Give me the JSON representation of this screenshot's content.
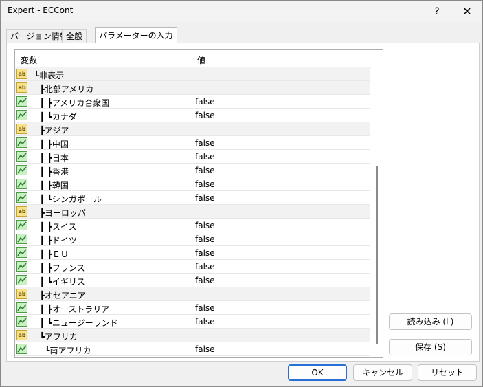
{
  "window": {
    "title": "Expert - ECCont",
    "help": "?",
    "close": "✕"
  },
  "tabs": [
    "バージョン情報",
    "全般",
    "パラメーターの入力"
  ],
  "grid": {
    "col_variable": "変数",
    "col_value": "値",
    "rows": [
      {
        "type": "ab",
        "name": "└非表示",
        "value": ""
      },
      {
        "type": "ab",
        "name": "  ┣北部アメリカ",
        "value": ""
      },
      {
        "type": "bool",
        "name": "  ┃ ┣アメリカ合衆国",
        "value": "false"
      },
      {
        "type": "bool",
        "name": "  ┃ ┗カナダ",
        "value": "false"
      },
      {
        "type": "ab",
        "name": "  ┣アジア",
        "value": ""
      },
      {
        "type": "bool",
        "name": "  ┃ ┣中国",
        "value": "false"
      },
      {
        "type": "bool",
        "name": "  ┃ ┣日本",
        "value": "false"
      },
      {
        "type": "bool",
        "name": "  ┃ ┣香港",
        "value": "false"
      },
      {
        "type": "bool",
        "name": "  ┃ ┣韓国",
        "value": "false"
      },
      {
        "type": "bool",
        "name": "  ┃ ┗シンガポール",
        "value": "false"
      },
      {
        "type": "ab",
        "name": "  ┣ヨーロッパ",
        "value": ""
      },
      {
        "type": "bool",
        "name": "  ┃ ┣スイス",
        "value": "false"
      },
      {
        "type": "bool",
        "name": "  ┃ ┣ドイツ",
        "value": "false"
      },
      {
        "type": "bool",
        "name": "  ┃ ┣ＥＵ",
        "value": "false"
      },
      {
        "type": "bool",
        "name": "  ┃ ┣フランス",
        "value": "false"
      },
      {
        "type": "bool",
        "name": "  ┃ ┗イギリス",
        "value": "false"
      },
      {
        "type": "ab",
        "name": "  ┣オセアニア",
        "value": ""
      },
      {
        "type": "bool",
        "name": "  ┃ ┣オーストラリア",
        "value": "false"
      },
      {
        "type": "bool",
        "name": "  ┃ ┗ニュージーランド",
        "value": "false"
      },
      {
        "type": "ab",
        "name": "  ┗アフリカ",
        "value": ""
      },
      {
        "type": "bool",
        "name": "    ┗南アフリカ",
        "value": "false"
      }
    ]
  },
  "buttons": {
    "load": "読み込み (L)",
    "save": "保存 (S)",
    "ok": "OK",
    "cancel": "キャンセル",
    "reset": "リセット"
  },
  "icons": {
    "string_param": "ab",
    "bool_param": "bool-chart-icon"
  }
}
